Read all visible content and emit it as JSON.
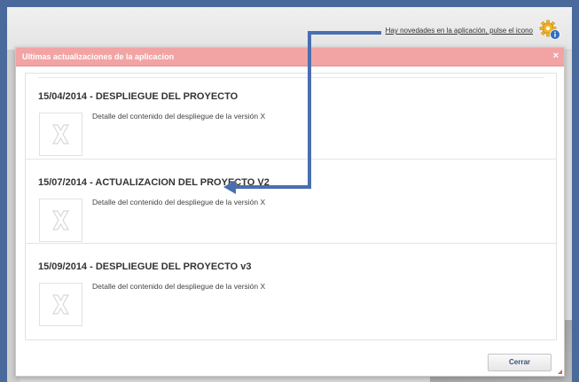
{
  "app": {
    "notice_text": "Hay novedades en la aplicación, pulse el icono",
    "notice_icon": "gear-info-icon"
  },
  "modal": {
    "title": "Ultimas actualizaciones de la aplicacion",
    "close_label": "×",
    "close_button_label": "Cerrar",
    "entries": [
      {
        "title": "15/04/2014 - DESPLIEGUE DEL PROYECTO",
        "description": "Detalle del contenido del despliegue de la versión X",
        "thumb_icon": "placeholder-x-icon"
      },
      {
        "title": "15/07/2014 - ACTUALIZACION DEL PROYECTO V2",
        "description": "Detalle del contenido del despliegue de la versión X",
        "thumb_icon": "placeholder-x-icon"
      },
      {
        "title": "15/09/2014 - DESPLIEGUE DEL PROYECTO v3",
        "description": "Detalle del contenido del despliegue de la versión X",
        "thumb_icon": "placeholder-x-icon"
      }
    ]
  },
  "colors": {
    "header": "#f2a4a4",
    "annotation_arrow": "#4a6fb0",
    "button_text": "#3a4f7a"
  }
}
